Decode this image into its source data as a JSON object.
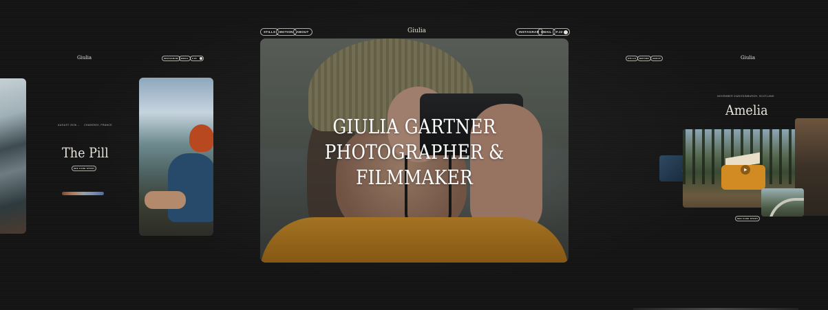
{
  "left_card": {
    "logo": "Giulia",
    "nav_right": [
      "INSTAGRAM",
      "EMAIL",
      "F.22"
    ],
    "date": "AUGUST 2026",
    "arrow": "→",
    "location": "CHAMONIX, FRANCE",
    "title": "The Pill",
    "case_button": "SEE CASE STUDY"
  },
  "main_card": {
    "nav_left": [
      "STILLS",
      "MOTION",
      "ABOUT"
    ],
    "logo": "Giulia",
    "nav_right": [
      "INSTAGRAM",
      "EMAIL",
      "F.22"
    ],
    "headline": [
      "GIULIA GARTNER",
      "PHOTOGRAPHER &",
      "FILMMAKER"
    ]
  },
  "right_card": {
    "nav_left": [
      "STILLS",
      "MOTION",
      "ABOUT"
    ],
    "logo": "Giulia",
    "date": "NOVEMBER 2025",
    "arrow": "→",
    "location": "EDINBURGH, SCOTLAND",
    "title": "Amelia",
    "case_button": "SEE CASE STUDY"
  },
  "icons": {
    "toggle": "toggle-dot-icon",
    "play": "play-icon",
    "arrow": "arrow-right-icon"
  },
  "colors": {
    "background": "#141414",
    "text": "#e6e2da",
    "jacket_accent": "#c88c2a"
  }
}
